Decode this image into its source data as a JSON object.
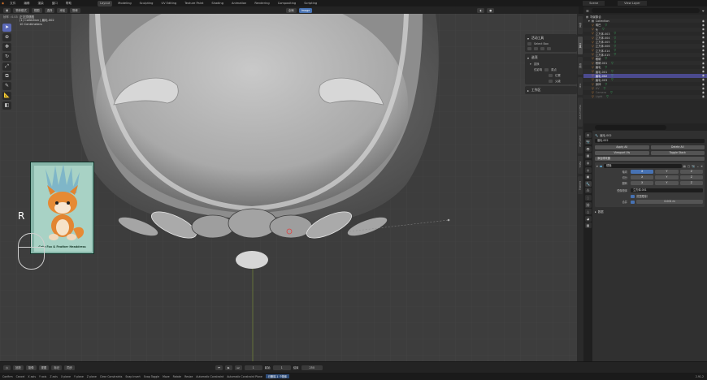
{
  "topbar": {
    "menus": [
      "文件",
      "编辑",
      "渲染",
      "窗口",
      "帮助"
    ],
    "workspaces": [
      "Layout",
      "Modeling",
      "Sculpting",
      "UV Editing",
      "Texture Paint",
      "Shading",
      "Animation",
      "Rendering",
      "Compositing",
      "Scripting"
    ],
    "active_workspace": "Layout",
    "scene": "Scene",
    "view_layer": "View Layer"
  },
  "viewport_header": {
    "mode": "物体模式",
    "view": "视图",
    "select": "选择",
    "add": "添加",
    "object": "物体",
    "orientation": "全局",
    "snapping": "Image"
  },
  "viewport_info": {
    "view_name": "正交顶视图",
    "collection": "(1) Collection | 眉毛.002",
    "scale": "10 Centimeters",
    "frame": "帧率 : 0.03"
  },
  "tools": [
    "select",
    "cursor",
    "move",
    "rotate",
    "scale",
    "transform",
    "annotate",
    "measure",
    "add-cube"
  ],
  "npanel": {
    "active_tool_title": "活动工具",
    "select_box_label": "Select Box",
    "options_title": "选项",
    "transform_title": "变换",
    "affect_only_label": "仅影响",
    "affect_origins": "原点",
    "affect_locations": "位置",
    "affect_parents": "父级",
    "workspace_title": "工作区"
  },
  "sidebar_tabs": [
    "物体",
    "工具",
    "视图",
    "Edit",
    "Shortcut VUr",
    "Animation",
    "Extra",
    "AutoRig"
  ],
  "thumbnail": {
    "caption": "Cute Fox & Feather Headdress"
  },
  "overlay": {
    "key": "R"
  },
  "outliner": {
    "search_placeholder": "",
    "scene_collection": "场景集合",
    "collection_name": "Collection",
    "items": [
      {
        "name": "嘴巴",
        "state": "normal"
      },
      {
        "name": "头",
        "state": "normal"
      },
      {
        "name": "立方体.003",
        "state": "normal"
      },
      {
        "name": "立方体.004",
        "state": "normal"
      },
      {
        "name": "立方体.005",
        "state": "normal"
      },
      {
        "name": "立方体.006",
        "state": "normal"
      },
      {
        "name": "立方体.014",
        "state": "normal"
      },
      {
        "name": "立方体.015",
        "state": "normal"
      },
      {
        "name": "眼睛",
        "state": "normal"
      },
      {
        "name": "眼睛.001",
        "state": "normal"
      },
      {
        "name": "眉毛",
        "state": "normal"
      },
      {
        "name": "眉毛.001",
        "state": "normal"
      },
      {
        "name": "眉毛.002",
        "state": "selected"
      },
      {
        "name": "眉毛.003",
        "state": "normal"
      },
      {
        "name": "身体",
        "state": "normal"
      },
      {
        "name": "UV",
        "state": "dim"
      },
      {
        "name": "Camera",
        "state": "dim"
      },
      {
        "name": "Light",
        "state": "dim"
      }
    ]
  },
  "properties": {
    "object_name": "眉毛.002",
    "modifier_header": "眉毛.002",
    "buttons": [
      "Apply All",
      "Delete All",
      "Viewport Vis",
      "Toggle Stack"
    ],
    "add_modifier": "添加修改器",
    "modifier_name": "镜像",
    "axis_label": "轴向",
    "bisect_label": "切分",
    "flip_label": "翻转",
    "axes": [
      "X",
      "Y",
      "Z"
    ],
    "mirror_object_label": "镜像物体",
    "mirror_object_value": "立方体.001",
    "clipping_label": "范围限制",
    "merge_label": "合并",
    "merge_value": "0.001 m",
    "data_label": "数据"
  },
  "timeline": {
    "playback": "回放",
    "keying": "抠像",
    "view": "视图",
    "marker": "标记",
    "sync": "同步",
    "frame_current": "1",
    "start": "起始",
    "start_value": "1",
    "end": "结束",
    "end_value": "250"
  },
  "statusbar": {
    "items": [
      "Confirm",
      "Cancel",
      "X axis",
      "Y axis",
      "Z axis",
      "X plane",
      "Y plane",
      "Z plane",
      "Clear Constraints",
      "Snap Invert",
      "Snap Toggle",
      "Move",
      "Rotate",
      "Resize",
      "Automatic Constraint",
      "Automatic Constraint Plane"
    ],
    "tip": "已删除 1 个物体",
    "version": "2.91.2"
  },
  "colors": {
    "accent": "#4772b3",
    "selection": "#4b4a8e",
    "viewport_bg": "#3d3d3d",
    "outliner_icon": "#e08a36",
    "modifier_icon": "#68c5ff"
  }
}
